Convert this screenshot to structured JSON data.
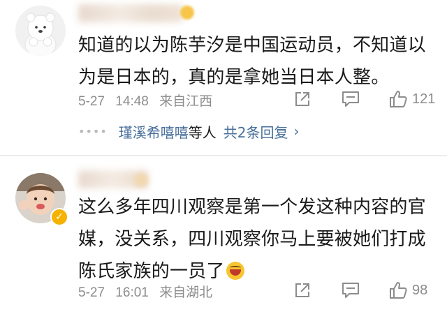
{
  "comments": [
    {
      "username": "",
      "text_lines": [
        "知道的以为陈芋汐是中国运动员，不知道以",
        "为是日本的，真的是拿她当日本人整。"
      ],
      "date": "5-27",
      "time": "14:48",
      "location": "来自江西",
      "likes": "121",
      "replies": {
        "names": "瑾溪希嘻嘻",
        "etc": "等人",
        "count": "共2条回复"
      }
    },
    {
      "username": "",
      "text_lines": [
        "这么多年四川观察是第一个发这种内容的官",
        "媒，没关系，四川观察你马上要被她们打成",
        "陈氏家族的一员了"
      ],
      "date": "5-27",
      "time": "16:01",
      "location": "来自湖北",
      "likes": "98"
    }
  ],
  "icons": {
    "share": "share-icon",
    "comment": "comment-icon",
    "like": "thumbs-up-icon",
    "emoji": "laughing-emoji-icon",
    "verified": "verified-badge-icon"
  },
  "colors": {
    "link": "#48709b",
    "meta": "#8c8c8c",
    "text": "#1a1a1a",
    "badge": "#f5b200"
  }
}
